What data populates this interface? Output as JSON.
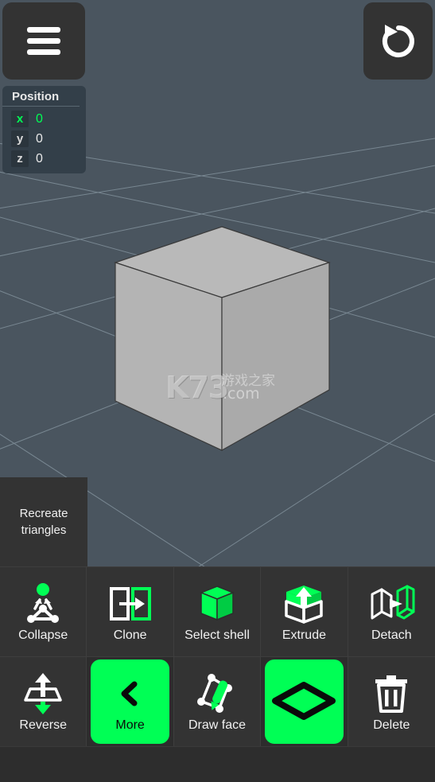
{
  "app": {
    "background_color": "#2d2d2d",
    "viewport_color": "#4a555f",
    "accent_color": "#00ff55",
    "panel_color": "#333333"
  },
  "topbar": {
    "menu_button": {
      "icon": "hamburger-menu-icon",
      "label": "Menu"
    },
    "undo_button": {
      "icon": "undo-icon",
      "label": "Undo"
    }
  },
  "position_panel": {
    "title": "Position",
    "axes": [
      {
        "axis": "x",
        "value": "0",
        "active": true
      },
      {
        "axis": "y",
        "value": "0",
        "active": false
      },
      {
        "axis": "z",
        "value": "0",
        "active": false
      }
    ]
  },
  "viewport": {
    "object": "cube",
    "watermark": {
      "brand": "K73",
      "chinese": "游戏之家",
      "domain": ".com"
    }
  },
  "recreate_panel": {
    "label": "Recreate triangles"
  },
  "toolbar": {
    "rows": [
      [
        {
          "label": "Collapse",
          "icon": "collapse-icon",
          "highlight": false
        },
        {
          "label": "Clone",
          "icon": "clone-icon",
          "highlight": false
        },
        {
          "label": "Select shell",
          "icon": "select-shell-icon",
          "highlight": false
        },
        {
          "label": "Extrude",
          "icon": "extrude-icon",
          "highlight": false
        },
        {
          "label": "Detach",
          "icon": "detach-icon",
          "highlight": false
        }
      ],
      [
        {
          "label": "Reverse",
          "icon": "reverse-icon",
          "highlight": false
        },
        {
          "label": "More",
          "icon": "chevron-left-icon",
          "highlight": true
        },
        {
          "label": "Draw face",
          "icon": "draw-face-icon",
          "highlight": false
        },
        {
          "label": "",
          "icon": "face-select-icon",
          "highlight": true
        },
        {
          "label": "Delete",
          "icon": "trash-icon",
          "highlight": false
        }
      ]
    ]
  }
}
